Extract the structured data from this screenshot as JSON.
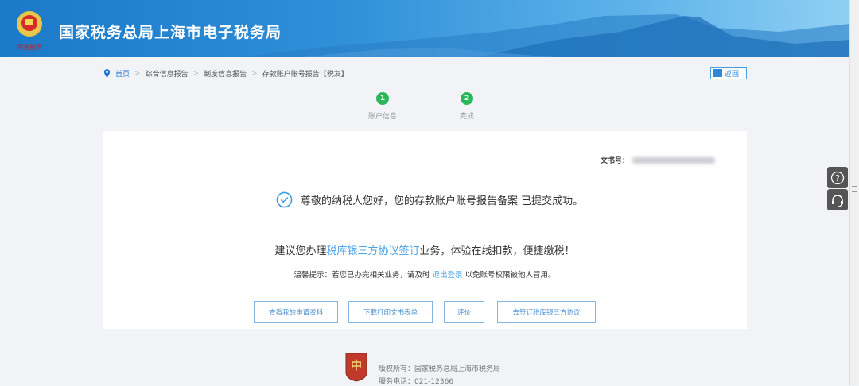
{
  "header": {
    "title": "国家税务总局上海市电子税务局"
  },
  "breadcrumb": [
    "首页",
    "综合信息报告",
    "制度信息报告",
    "存款账户账号报告【税友】"
  ],
  "back_label": "返回",
  "steps": [
    {
      "num": "1",
      "label": "账户信息"
    },
    {
      "num": "2",
      "label": "完成"
    }
  ],
  "card": {
    "doc_label": "文书号：",
    "success_msg": "尊敬的纳税人您好，您的存款账户账号报告备案 已提交成功。",
    "suggest_pre": "建议您办理",
    "suggest_link": "税库银三方协议签订",
    "suggest_post": "业务，体验在线扣款，便捷缴税！",
    "tip_pre": "温馨提示：若您已办完相关业务，请及时 ",
    "tip_link": "退出登录",
    "tip_post": " 以免账号权限被他人冒用。",
    "buttons": [
      "查看我的申请资料",
      "下载打印文书表单",
      "评价",
      "去签订税库银三方协议"
    ]
  },
  "footer": {
    "copyright": "版权所有：国家税务总局上海市税务局",
    "phone": "服务电话：021-12366"
  },
  "colors": {
    "brand": "#1c76d2",
    "success": "#2ab75a",
    "link": "#4aa3e8"
  }
}
